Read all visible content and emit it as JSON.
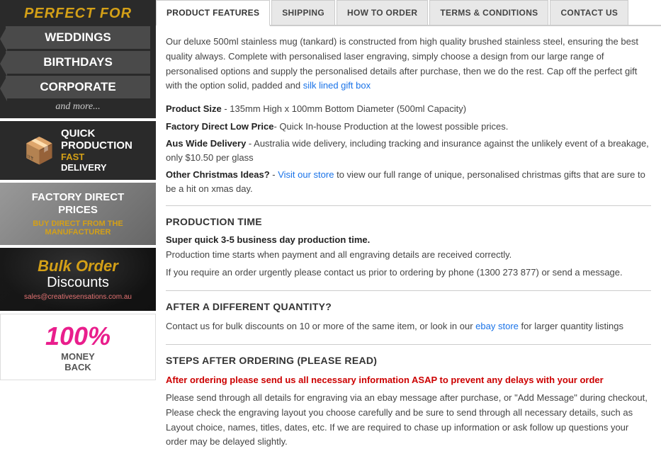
{
  "sidebar": {
    "perfect_for_title": "PERFECT FOR",
    "pf_items": [
      "WEDDINGS",
      "BIRTHDAYS",
      "CORPORATE"
    ],
    "pf_more": "and more...",
    "quick_prod": {
      "line1": "QUICK\nPRODUCTION",
      "line2": "FAST",
      "line3": "DELIVERY"
    },
    "factory": {
      "title": "FACTORY DIRECT\nPRICES",
      "sub": "BUY DIRECT FROM THE\nMANUFACTURER"
    },
    "bulk": {
      "title_pre": "Bulk ",
      "title_main": "Order",
      "title_sub": "Discounts",
      "email": "sales@creativesensations.com.au"
    },
    "money": {
      "pct": "100%",
      "line1": "Money",
      "line2": "Back"
    }
  },
  "tabs": [
    {
      "label": "PRODUCT FEATURES",
      "active": true
    },
    {
      "label": "SHIPPING",
      "active": false
    },
    {
      "label": "HOW TO ORDER",
      "active": false
    },
    {
      "label": "TERMS & CONDITIONS",
      "active": false
    },
    {
      "label": "CONTACT US",
      "active": false
    }
  ],
  "product_features": {
    "intro": "Our deluxe 500ml stainless mug (tankard) is constructed from high quality brushed stainless steel, ensuring the best quality always. Complete with personalised laser engraving, simply choose a design from our large range of personalised options and supply the personalised details after purchase, then we do the rest. Cap off the perfect gift with the option solid, padded and silk lined gift box",
    "details": [
      {
        "bold": "Product Size",
        "text": " - 135mm High x 100mm Bottom Diameter (500ml Capacity)"
      },
      {
        "bold": "Factory Direct Low Price",
        "text": "- Quick In-house Production at the lowest possible prices."
      },
      {
        "bold": "Aus Wide Delivery",
        "text": " - Australia wide delivery, including tracking and insurance against the unlikely event of a breakage, only $10.50 per glass"
      },
      {
        "bold": "Other Christmas Ideas?",
        "text": " - ",
        "link_text": "Visit our store",
        "link_after": " to view our full range of unique, personalised christmas gifts that are sure to be a hit on xmas day."
      }
    ],
    "production_time": {
      "heading": "PRODUCTION TIME",
      "bold_line": "Super quick 3-5 business day production time.",
      "line1": "Production time starts when payment and all engraving details are received correctly.",
      "line2": "If you require an order urgently please contact us prior to ordering by phone (1300 273 877) or send a message."
    },
    "after_qty": {
      "heading": "AFTER A DIFFERENT QUANTITY?",
      "text": "Contact us for bulk discounts on 10 or more of the same item, or look in our ",
      "link_text": "ebay store",
      "text_after": " for larger quantity listings"
    },
    "steps": {
      "heading": "STEPS AFTER ORDERING (PLEASE READ)",
      "urgent": "After ordering please send us all necessary information ASAP to prevent any delays with your order",
      "text": "Please send through all details for engraving via an ebay message after purchase, or \"Add Message\" during checkout, Please check the engraving layout you choose carefully and be sure to send through all necessary details, such as Layout choice, names, titles, dates, etc. If we are required to chase up information or ask follow up questions your order may be delayed slightly."
    }
  }
}
